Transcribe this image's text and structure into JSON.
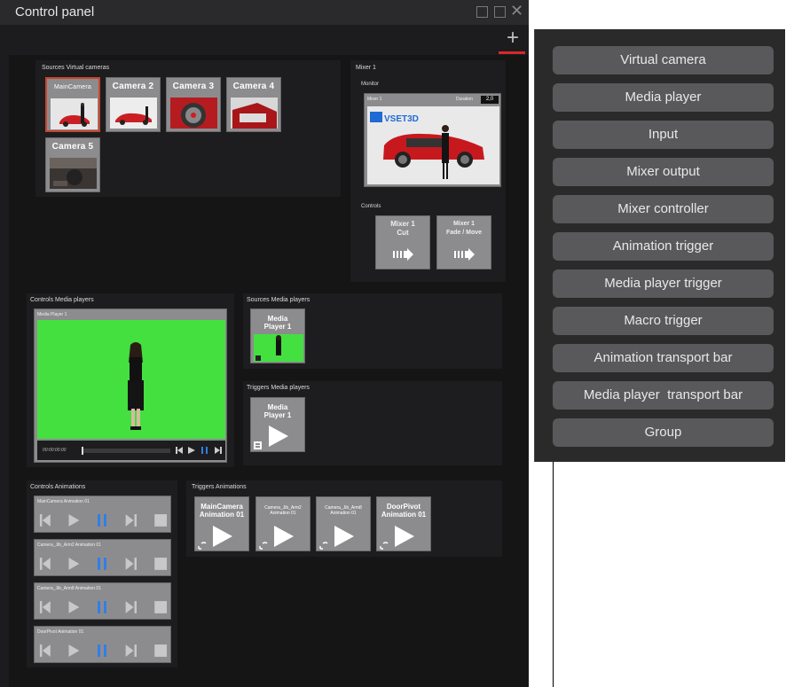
{
  "window": {
    "title": "Control panel",
    "add_icon": "plus-icon"
  },
  "sources_cameras": {
    "title": "Sources Virtual cameras",
    "cameras": [
      {
        "label": "MainCamera",
        "selected": true
      },
      {
        "label": "Camera 2"
      },
      {
        "label": "Camera 3"
      },
      {
        "label": "Camera 4"
      },
      {
        "label": "Camera 5"
      }
    ]
  },
  "mixer": {
    "title": "Mixer 1",
    "monitor_title": "Monitor",
    "monitor_label": "Mixer 1",
    "duration_label": "Duration",
    "duration_value": "2,0",
    "logo_text": "VSET3D",
    "controls_title": "Controls",
    "cut_label_1": "Mixer 1",
    "cut_label_2": "Cut",
    "fade_label_1": "Mixer 1",
    "fade_label_2": "Fade / Move"
  },
  "media_players": {
    "controls_title": "Controls Media players",
    "player_label": "Media Player 1",
    "timecode": "00:00:00:00",
    "sources_title": "Sources Media players",
    "source_label_1": "Media",
    "source_label_2": "Player 1",
    "triggers_title": "Triggers Media players",
    "trigger_label_1": "Media",
    "trigger_label_2": "Player 1"
  },
  "animations": {
    "controls_title": "Controls Animations",
    "items": [
      {
        "label": "MainCamera Animation 01"
      },
      {
        "label": "Camera_Jib_Arm2 Animation 01"
      },
      {
        "label": "Camera_Jib_Arm8 Animation 01"
      },
      {
        "label": "DoorPivot Animation 01"
      }
    ],
    "triggers_title": "Triggers Animations",
    "triggers": [
      {
        "l1": "MainCamera",
        "l2": "Animation 01"
      },
      {
        "l1": "Camera_Jib_Arm2",
        "l2": "Animation 01"
      },
      {
        "l1": "Camera_Jib_Arm8",
        "l2": "Animation 01"
      },
      {
        "l1": "DoorPivot",
        "l2": "Animation 01"
      }
    ]
  },
  "menu": {
    "items": [
      "Virtual camera",
      "Media player",
      "Input",
      "Mixer output",
      "Mixer controller",
      "Animation trigger",
      "Media player trigger",
      "Macro trigger",
      "Animation transport bar",
      "Media player  transport bar",
      "Group"
    ]
  },
  "colors": {
    "accent_red": "#d62a2a",
    "pause_blue": "#2f7fe8",
    "chroma_green": "#43e040"
  }
}
